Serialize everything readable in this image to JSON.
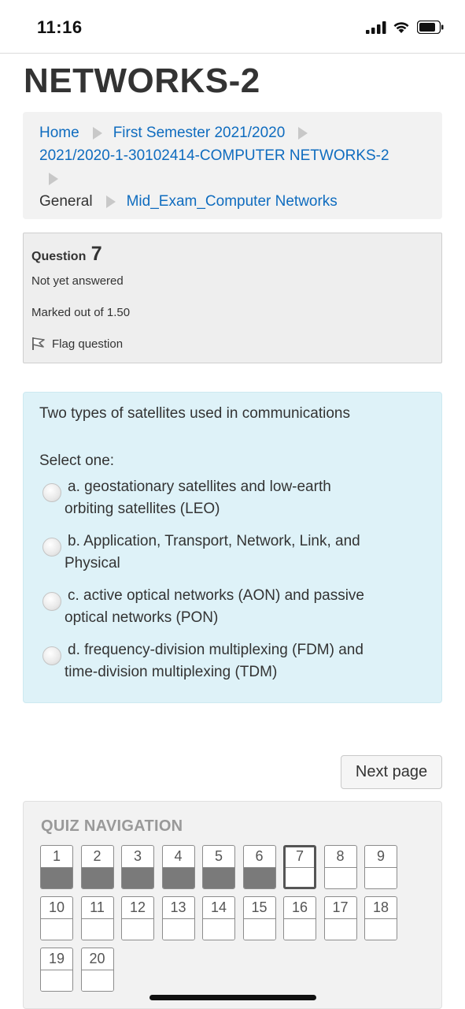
{
  "status_bar": {
    "time": "11:16",
    "icons": [
      "signal-bars-icon",
      "wifi-icon",
      "battery-icon"
    ]
  },
  "header": {
    "title": "NETWORKS-2"
  },
  "breadcrumb": {
    "items": [
      "Home",
      "First Semester 2021/2020",
      "2021/2020-1-30102414-COMPUTER NETWORKS-2",
      "General",
      "Mid_Exam_Computer Networks"
    ]
  },
  "question_info": {
    "label": "Question",
    "number": "7",
    "state": "Not yet answered",
    "grade": "Marked out of 1.50",
    "flag_label": "Flag question"
  },
  "question": {
    "text": "Two types of satellites used in communications",
    "prompt": "Select one:",
    "answers": [
      {
        "line1": "a. geostationary satellites and low-earth",
        "line2": "orbiting satellites (LEO)"
      },
      {
        "line1": "b. Application, Transport, Network, Link, and",
        "line2": "Physical"
      },
      {
        "line1": "c. active optical networks (AON) and passive",
        "line2": "optical networks (PON)"
      },
      {
        "line1": "d. frequency-division multiplexing (FDM) and",
        "line2": "time-division multiplexing (TDM)"
      }
    ]
  },
  "next_button": {
    "label": "Next page"
  },
  "quiz_navigation": {
    "title": "QUIZ NAVIGATION",
    "current": 7,
    "buttons": [
      {
        "label": "1",
        "answered": true
      },
      {
        "label": "2",
        "answered": true
      },
      {
        "label": "3",
        "answered": true
      },
      {
        "label": "4",
        "answered": true
      },
      {
        "label": "5",
        "answered": true
      },
      {
        "label": "6",
        "answered": true
      },
      {
        "label": "7",
        "answered": false
      },
      {
        "label": "8",
        "answered": false
      },
      {
        "label": "9",
        "answered": false
      },
      {
        "label": "10",
        "answered": false
      },
      {
        "label": "11",
        "answered": false
      },
      {
        "label": "12",
        "answered": false
      },
      {
        "label": "13",
        "answered": false
      },
      {
        "label": "14",
        "answered": false
      },
      {
        "label": "15",
        "answered": false
      },
      {
        "label": "16",
        "answered": false
      },
      {
        "label": "17",
        "answered": false
      },
      {
        "label": "18",
        "answered": false
      },
      {
        "label": "19",
        "answered": false
      },
      {
        "label": "20",
        "answered": false
      }
    ]
  },
  "colors": {
    "link": "#0f6cbf",
    "question_bg": "#def2f8",
    "info_bg": "#eeeeee",
    "answered_state": "#7a7a7a"
  }
}
